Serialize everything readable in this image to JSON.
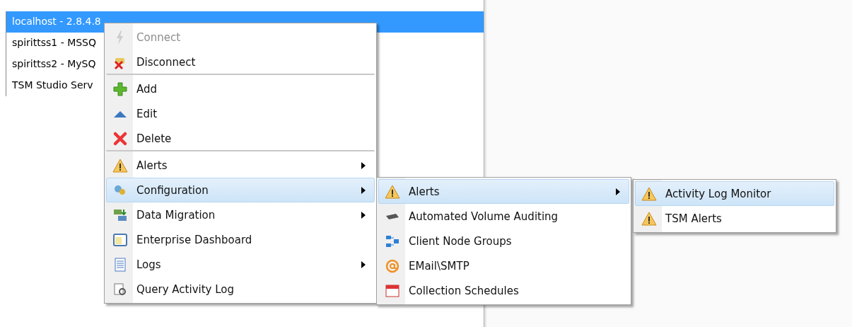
{
  "tree": {
    "items": [
      {
        "label": "localhost - 2.8.4.8",
        "selected": true
      },
      {
        "label": "spirittss1 - MSSQ",
        "selected": false
      },
      {
        "label": "spirittss2 - MySQ",
        "selected": false
      },
      {
        "label": "TSM Studio Serv",
        "selected": false
      }
    ]
  },
  "context_menu": {
    "items": [
      {
        "label": "Connect",
        "disabled": true,
        "selected": false,
        "submenu": false,
        "separator_after": false
      },
      {
        "label": "Disconnect",
        "disabled": false,
        "selected": false,
        "submenu": false,
        "separator_after": true
      },
      {
        "label": "Add",
        "disabled": false,
        "selected": false,
        "submenu": false,
        "separator_after": false
      },
      {
        "label": "Edit",
        "disabled": false,
        "selected": false,
        "submenu": false,
        "separator_after": false
      },
      {
        "label": "Delete",
        "disabled": false,
        "selected": false,
        "submenu": false,
        "separator_after": true
      },
      {
        "label": "Alerts",
        "disabled": false,
        "selected": false,
        "submenu": true,
        "separator_after": false
      },
      {
        "label": "Configuration",
        "disabled": false,
        "selected": true,
        "submenu": true,
        "separator_after": false
      },
      {
        "label": "Data Migration",
        "disabled": false,
        "selected": false,
        "submenu": true,
        "separator_after": false
      },
      {
        "label": "Enterprise Dashboard",
        "disabled": false,
        "selected": false,
        "submenu": false,
        "separator_after": false
      },
      {
        "label": "Logs",
        "disabled": false,
        "selected": false,
        "submenu": true,
        "separator_after": false
      },
      {
        "label": "Query Activity Log",
        "disabled": false,
        "selected": false,
        "submenu": false,
        "separator_after": false
      }
    ]
  },
  "configuration_submenu": {
    "items": [
      {
        "label": "Alerts",
        "selected": true,
        "submenu": true
      },
      {
        "label": "Automated Volume Auditing",
        "selected": false,
        "submenu": false
      },
      {
        "label": "Client Node Groups",
        "selected": false,
        "submenu": false
      },
      {
        "label": "EMail\\SMTP",
        "selected": false,
        "submenu": false
      },
      {
        "label": "Collection Schedules",
        "selected": false,
        "submenu": false
      }
    ]
  },
  "alerts_submenu": {
    "items": [
      {
        "label": "Activity Log Monitor",
        "selected": true,
        "submenu": false
      },
      {
        "label": "TSM Alerts",
        "selected": false,
        "submenu": false
      }
    ]
  }
}
